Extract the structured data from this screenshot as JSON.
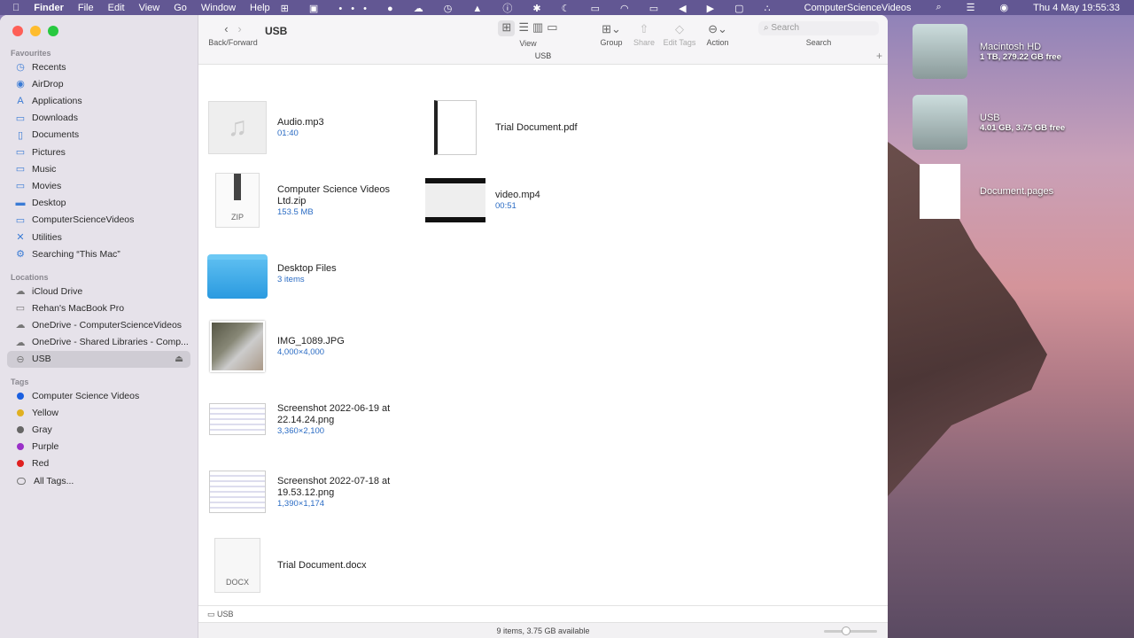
{
  "menubar": {
    "apple": "",
    "app": "Finder",
    "menus": [
      "File",
      "Edit",
      "View",
      "Go",
      "Window",
      "Help"
    ],
    "user": "ComputerScienceVideos",
    "datetime": "Thu 4 May  19:55:33"
  },
  "window": {
    "title": "USB",
    "back_forward": "Back/Forward",
    "view": "View",
    "group": "Group",
    "share": "Share",
    "edit_tags": "Edit Tags",
    "action": "Action",
    "search_placeholder": "Search",
    "search_label": "Search",
    "tab_title": "USB",
    "add_tab": "+"
  },
  "sidebar": {
    "favourites_label": "Favourites",
    "favourites": [
      {
        "label": "Recents",
        "icon": "◷"
      },
      {
        "label": "AirDrop",
        "icon": "◉"
      },
      {
        "label": "Applications",
        "icon": "A"
      },
      {
        "label": "Downloads",
        "icon": "▭"
      },
      {
        "label": "Documents",
        "icon": "▯"
      },
      {
        "label": "Pictures",
        "icon": "▭"
      },
      {
        "label": "Music",
        "icon": "▭"
      },
      {
        "label": "Movies",
        "icon": "▭"
      },
      {
        "label": "Desktop",
        "icon": "▬"
      },
      {
        "label": "ComputerScienceVideos",
        "icon": "▭"
      },
      {
        "label": "Utilities",
        "icon": "✕"
      },
      {
        "label": "Searching “This Mac”",
        "icon": "⚙"
      }
    ],
    "locations_label": "Locations",
    "locations": [
      {
        "label": "iCloud Drive",
        "icon": "☁"
      },
      {
        "label": "Rehan's MacBook Pro",
        "icon": "▭"
      },
      {
        "label": "OneDrive - ComputerScienceVideos",
        "icon": "☁"
      },
      {
        "label": "OneDrive - Shared Libraries - Comp...",
        "icon": "☁"
      },
      {
        "label": "USB",
        "icon": "⊖",
        "selected": true
      }
    ],
    "eject": "⏏",
    "tags_label": "Tags",
    "tags": [
      {
        "label": "Computer Science Videos",
        "color": "#1a5fe0"
      },
      {
        "label": "Yellow",
        "color": "#e0b020"
      },
      {
        "label": "Gray",
        "color": "#666666"
      },
      {
        "label": "Purple",
        "color": "#9a30c8"
      },
      {
        "label": "Red",
        "color": "#e02020"
      },
      {
        "label": "All Tags...",
        "color": ""
      }
    ]
  },
  "files": [
    {
      "name": "Audio.mp3",
      "sub": "01:40",
      "type": "audio"
    },
    {
      "name": "Trial Document.pdf",
      "sub": "",
      "type": "pdf"
    },
    {
      "name": "Computer Science Videos Ltd.zip",
      "sub": "153.5 MB",
      "type": "zip",
      "badge": "ZIP"
    },
    {
      "name": "video.mp4",
      "sub": "00:51",
      "type": "video"
    },
    {
      "name": "Desktop Files",
      "sub": "3 items",
      "type": "folder"
    },
    {
      "name": "IMG_1089.JPG",
      "sub": "4,000×4,000",
      "type": "image"
    },
    {
      "name": "Screenshot 2022-06-19 at 22.14.24.png",
      "sub": "3,360×2,100",
      "type": "screenshot"
    },
    {
      "name": "Screenshot 2022-07-18 at 19.53.12.png",
      "sub": "1,390×1,174",
      "type": "screenshot"
    },
    {
      "name": "Trial Document.docx",
      "sub": "",
      "type": "docx",
      "badge": "DOCX"
    }
  ],
  "pathbar": "USB",
  "status": "9 items, 3.75 GB available",
  "desktop": [
    {
      "name": "Macintosh HD",
      "sub": "1 TB, 279.22 GB free"
    },
    {
      "name": "USB",
      "sub": "4.01 GB, 3.75 GB free"
    },
    {
      "name": "Document.pages",
      "sub": ""
    }
  ]
}
